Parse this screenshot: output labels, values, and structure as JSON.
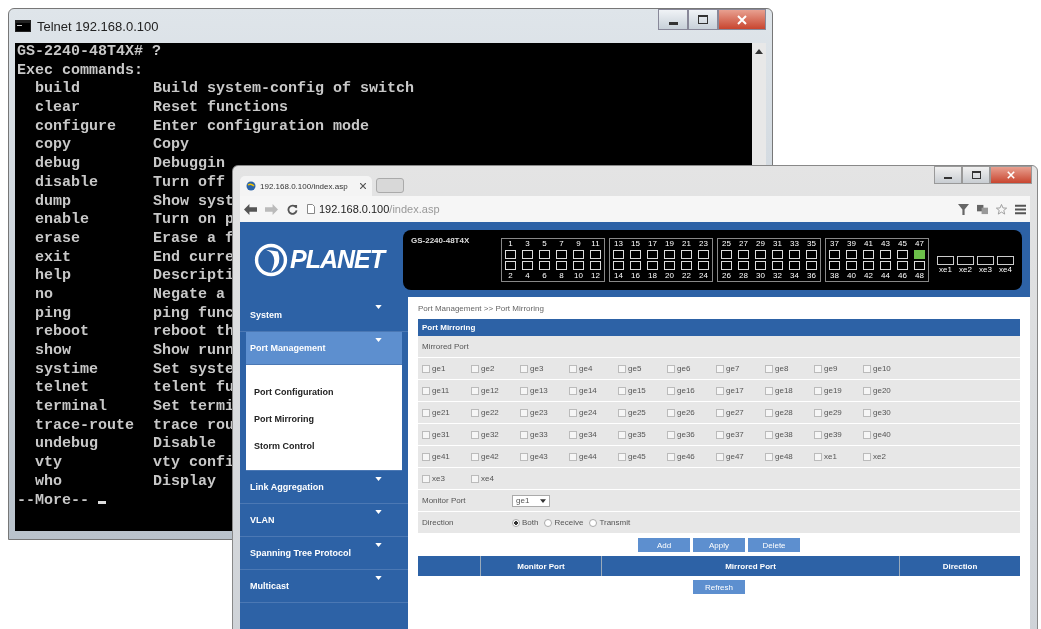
{
  "terminal": {
    "title": "Telnet 192.168.0.100",
    "prompt": "GS-2240-48T4X# ?",
    "heading": "Exec commands:",
    "commands": [
      {
        "name": "build",
        "description": "Build system-config of switch"
      },
      {
        "name": "clear",
        "description": "Reset functions"
      },
      {
        "name": "configure",
        "description": "Enter configuration mode"
      },
      {
        "name": "copy",
        "description": "Copy"
      },
      {
        "name": "debug",
        "description": "Debuggin"
      },
      {
        "name": "disable",
        "description": "Turn off"
      },
      {
        "name": "dump",
        "description": "Show syst"
      },
      {
        "name": "enable",
        "description": "Turn on p"
      },
      {
        "name": "erase",
        "description": "Erase a f"
      },
      {
        "name": "exit",
        "description": "End curre"
      },
      {
        "name": "help",
        "description": "Descripti"
      },
      {
        "name": "no",
        "description": "Negate a"
      },
      {
        "name": "ping",
        "description": "ping func"
      },
      {
        "name": "reboot",
        "description": "reboot th"
      },
      {
        "name": "show",
        "description": "Show runn"
      },
      {
        "name": "systime",
        "description": "Set syste"
      },
      {
        "name": "telnet",
        "description": "telent fu"
      },
      {
        "name": "terminal",
        "description": "Set termi"
      },
      {
        "name": "trace-route",
        "description": "trace rou"
      },
      {
        "name": "undebug",
        "description": "Disable"
      },
      {
        "name": "vty",
        "description": "vty confi"
      },
      {
        "name": "who",
        "description": "Display"
      }
    ],
    "more": "--More--"
  },
  "browser": {
    "tab_title": "192.168.0.100/index.asp",
    "url_host": "192.168.0.100",
    "url_path": "/index.asp"
  },
  "page": {
    "logo": "PLANET",
    "model": "GS-2240-48T4X",
    "ports": [
      {
        "label": "1",
        "up": false
      },
      {
        "label": "2",
        "up": false
      },
      {
        "label": "3",
        "up": false
      },
      {
        "label": "4",
        "up": false
      },
      {
        "label": "5",
        "up": false
      },
      {
        "label": "6",
        "up": false
      },
      {
        "label": "7",
        "up": false
      },
      {
        "label": "8",
        "up": false
      },
      {
        "label": "9",
        "up": false
      },
      {
        "label": "10",
        "up": false
      },
      {
        "label": "11",
        "up": false
      },
      {
        "label": "12",
        "up": false
      },
      {
        "label": "13",
        "up": false
      },
      {
        "label": "14",
        "up": false
      },
      {
        "label": "15",
        "up": false
      },
      {
        "label": "16",
        "up": false
      },
      {
        "label": "17",
        "up": false
      },
      {
        "label": "18",
        "up": false
      },
      {
        "label": "19",
        "up": false
      },
      {
        "label": "20",
        "up": false
      },
      {
        "label": "21",
        "up": false
      },
      {
        "label": "22",
        "up": false
      },
      {
        "label": "23",
        "up": false
      },
      {
        "label": "24",
        "up": false
      },
      {
        "label": "25",
        "up": false
      },
      {
        "label": "26",
        "up": false
      },
      {
        "label": "27",
        "up": false
      },
      {
        "label": "28",
        "up": false
      },
      {
        "label": "29",
        "up": false
      },
      {
        "label": "30",
        "up": false
      },
      {
        "label": "31",
        "up": false
      },
      {
        "label": "32",
        "up": false
      },
      {
        "label": "33",
        "up": false
      },
      {
        "label": "34",
        "up": false
      },
      {
        "label": "35",
        "up": false
      },
      {
        "label": "36",
        "up": false
      },
      {
        "label": "37",
        "up": false
      },
      {
        "label": "38",
        "up": false
      },
      {
        "label": "39",
        "up": false
      },
      {
        "label": "40",
        "up": false
      },
      {
        "label": "41",
        "up": false
      },
      {
        "label": "42",
        "up": false
      },
      {
        "label": "43",
        "up": false
      },
      {
        "label": "44",
        "up": false
      },
      {
        "label": "45",
        "up": false
      },
      {
        "label": "46",
        "up": false
      },
      {
        "label": "47",
        "up": true
      },
      {
        "label": "48",
        "up": false
      }
    ],
    "uplinks": [
      "xe1",
      "xe2",
      "xe3",
      "xe4"
    ],
    "sidebar": [
      {
        "label": "System",
        "selected": false
      },
      {
        "label": "Port Management",
        "selected": true,
        "children": [
          {
            "label": "Port Configuration"
          },
          {
            "label": "Port Mirroring"
          },
          {
            "label": "Storm Control"
          }
        ]
      },
      {
        "label": "Link Aggregation",
        "selected": false
      },
      {
        "label": "VLAN",
        "selected": false
      },
      {
        "label": "Spanning Tree Protocol",
        "selected": false
      },
      {
        "label": "Multicast",
        "selected": false
      }
    ],
    "breadcrumb": "Port Management >> Port Mirroring",
    "section_title": "Port Mirroring",
    "mirrored_port_label": "Mirrored Port",
    "mirrored_ports": [
      {
        "label": "ge1",
        "checked": false
      },
      {
        "label": "ge2",
        "checked": false
      },
      {
        "label": "ge3",
        "checked": false
      },
      {
        "label": "ge4",
        "checked": false
      },
      {
        "label": "ge5",
        "checked": false
      },
      {
        "label": "ge6",
        "checked": false
      },
      {
        "label": "ge7",
        "checked": false
      },
      {
        "label": "ge8",
        "checked": false
      },
      {
        "label": "ge9",
        "checked": false
      },
      {
        "label": "ge10",
        "checked": false
      },
      {
        "label": "ge11",
        "checked": false
      },
      {
        "label": "ge12",
        "checked": false
      },
      {
        "label": "ge13",
        "checked": false
      },
      {
        "label": "ge14",
        "checked": false
      },
      {
        "label": "ge15",
        "checked": false
      },
      {
        "label": "ge16",
        "checked": false
      },
      {
        "label": "ge17",
        "checked": false
      },
      {
        "label": "ge18",
        "checked": false
      },
      {
        "label": "ge19",
        "checked": false
      },
      {
        "label": "ge20",
        "checked": false
      },
      {
        "label": "ge21",
        "checked": false
      },
      {
        "label": "ge22",
        "checked": false
      },
      {
        "label": "ge23",
        "checked": false
      },
      {
        "label": "ge24",
        "checked": false
      },
      {
        "label": "ge25",
        "checked": false
      },
      {
        "label": "ge26",
        "checked": false
      },
      {
        "label": "ge27",
        "checked": false
      },
      {
        "label": "ge28",
        "checked": false
      },
      {
        "label": "ge29",
        "checked": false
      },
      {
        "label": "ge30",
        "checked": false
      },
      {
        "label": "ge31",
        "checked": false
      },
      {
        "label": "ge32",
        "checked": false
      },
      {
        "label": "ge33",
        "checked": false
      },
      {
        "label": "ge34",
        "checked": false
      },
      {
        "label": "ge35",
        "checked": false
      },
      {
        "label": "ge36",
        "checked": false
      },
      {
        "label": "ge37",
        "checked": false
      },
      {
        "label": "ge38",
        "checked": false
      },
      {
        "label": "ge39",
        "checked": false
      },
      {
        "label": "ge40",
        "checked": false
      },
      {
        "label": "ge41",
        "checked": false
      },
      {
        "label": "ge42",
        "checked": false
      },
      {
        "label": "ge43",
        "checked": false
      },
      {
        "label": "ge44",
        "checked": false
      },
      {
        "label": "ge45",
        "checked": false
      },
      {
        "label": "ge46",
        "checked": false
      },
      {
        "label": "ge47",
        "checked": false
      },
      {
        "label": "ge48",
        "checked": false
      },
      {
        "label": "xe1",
        "checked": false
      },
      {
        "label": "xe2",
        "checked": false
      },
      {
        "label": "xe3",
        "checked": false
      },
      {
        "label": "xe4",
        "checked": false
      }
    ],
    "monitor_port": {
      "label": "Monitor Port",
      "value": "ge1"
    },
    "direction": {
      "label": "Direction",
      "options": [
        {
          "label": "Both",
          "selected": true
        },
        {
          "label": "Receive",
          "selected": false
        },
        {
          "label": "Transmit",
          "selected": false
        }
      ]
    },
    "buttons": [
      "Add",
      "Apply",
      "Delete"
    ],
    "table": {
      "columns": [
        "Monitor Port",
        "Mirrored Port",
        "Direction"
      ]
    },
    "refresh": "Refresh"
  }
}
